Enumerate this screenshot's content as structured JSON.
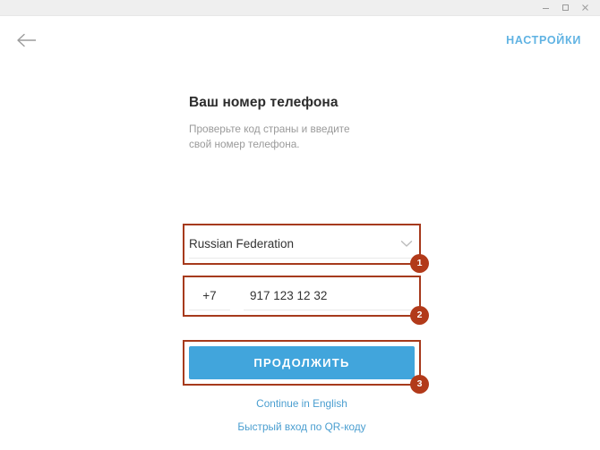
{
  "window": {
    "controls": [
      {
        "name": "minimize",
        "glyph": "minimize-icon"
      },
      {
        "name": "maximize",
        "glyph": "maximize-icon"
      },
      {
        "name": "close",
        "glyph": "close-icon"
      }
    ]
  },
  "topbar": {
    "back_icon": "arrow-left-icon",
    "settings_label": "НАСТРОЙКИ"
  },
  "form": {
    "title": "Ваш номер телефона",
    "subtitle": "Проверьте код страны и введите свой номер телефона.",
    "country": {
      "selected": "Russian Federation",
      "chevron_icon": "chevron-down-icon"
    },
    "phone": {
      "country_code": "+7",
      "number": "917 123 12 32"
    },
    "submit_label": "ПРОДОЛЖИТЬ",
    "links": [
      {
        "label": "Continue in English"
      },
      {
        "label": "Быстрый вход по QR-коду"
      }
    ]
  },
  "annotations": [
    {
      "badge": "1",
      "target": "country-select"
    },
    {
      "badge": "2",
      "target": "phone-input"
    },
    {
      "badge": "3",
      "target": "continue-button"
    }
  ],
  "colors": {
    "accent_blue": "#41a5dc",
    "link_blue": "#4a9ed0",
    "settings_blue": "#60b3e3",
    "annotation_red": "#a63a1c",
    "badge_red": "#b23a1a",
    "titlebar_gray": "#efefef"
  }
}
